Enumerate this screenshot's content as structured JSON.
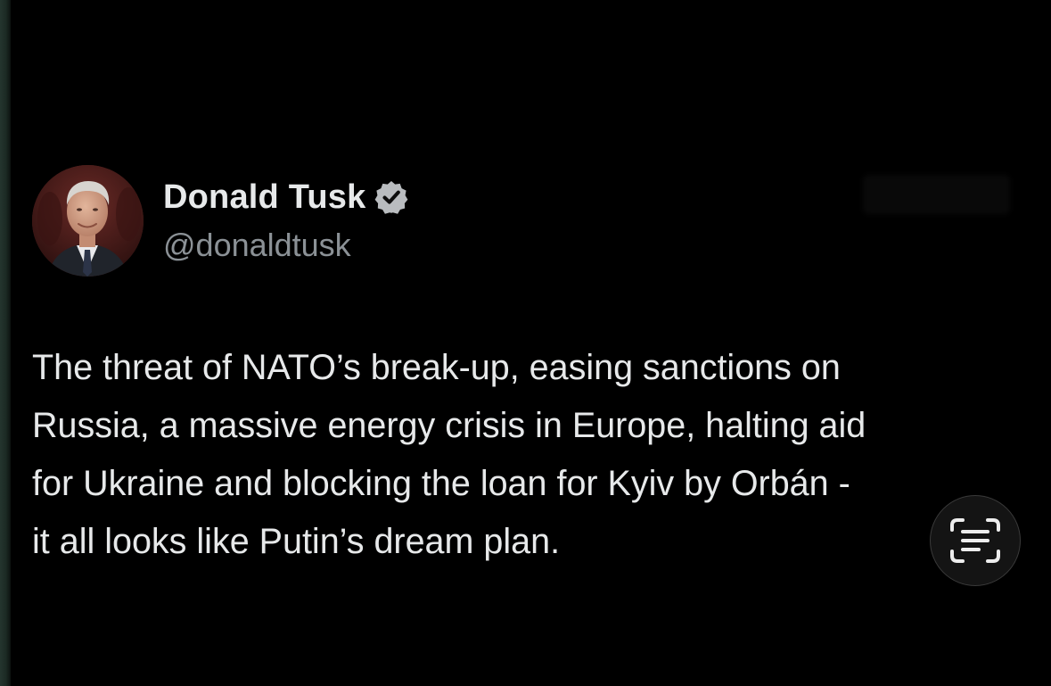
{
  "author": {
    "display_name": "Donald Tusk",
    "handle": "@donaldtusk",
    "verified": true,
    "avatar_icon": "profile-photo"
  },
  "tweet": {
    "lines": [
      "The threat of NATO’s break-up, easing sanctions on",
      "Russia, a massive energy crisis in Europe, halting aid",
      "for Ukraine and blocking the loan for Kyiv by Orbán -",
      "it all looks like Putin’s dream plan."
    ]
  },
  "overlay": {
    "live_text_icon": "live-text-icon"
  },
  "colors": {
    "background": "#000000",
    "text_primary": "#e7e9ea",
    "text_secondary": "#8b9196",
    "badge": "#b9bcbf"
  }
}
